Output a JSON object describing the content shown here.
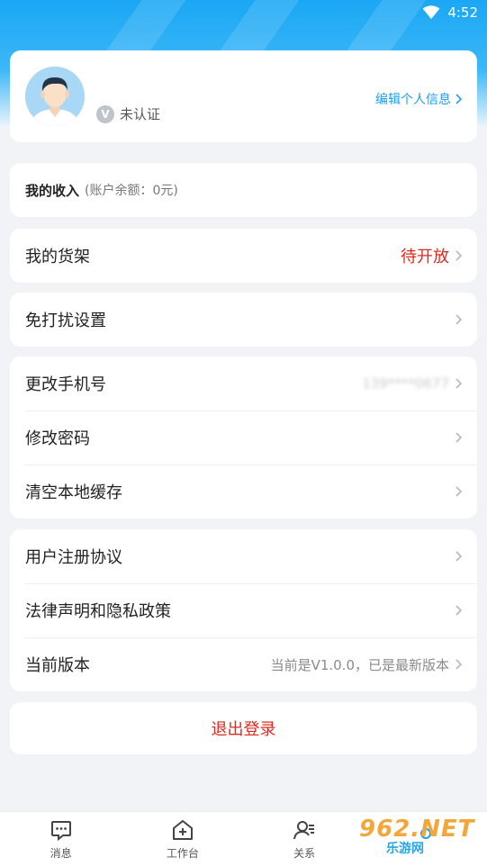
{
  "status_bar": {
    "time": "4:52"
  },
  "profile": {
    "verify_badge": "V",
    "verify_status": "未认证",
    "edit_link": "编辑个人信息"
  },
  "income": {
    "label": "我的收入",
    "balance": "(账户余额：0元)"
  },
  "shelf": {
    "label": "我的货架",
    "status": "待开放"
  },
  "dnd": {
    "label": "免打扰设置"
  },
  "account": {
    "change_phone": "更改手机号",
    "phone_value": "139****0677",
    "change_password": "修改密码",
    "clear_cache": "清空本地缓存"
  },
  "about": {
    "user_agreement": "用户注册协议",
    "legal_privacy": "法律声明和隐私政策",
    "version_label": "当前版本",
    "version_value": "当前是V1.0.0，已是最新版本"
  },
  "logout": {
    "label": "退出登录"
  },
  "tabbar": {
    "tabs": [
      {
        "label": "消息",
        "icon": "message-icon"
      },
      {
        "label": "工作台",
        "icon": "workbench-icon"
      },
      {
        "label": "关系",
        "icon": "contacts-icon"
      },
      {
        "label": "",
        "icon": "profile-icon"
      }
    ]
  },
  "watermark": {
    "big": "962.NET",
    "small": "乐游网"
  },
  "colors": {
    "accent": "#1a9ff2",
    "danger": "#e0291e",
    "background": "#f2f3f6"
  }
}
